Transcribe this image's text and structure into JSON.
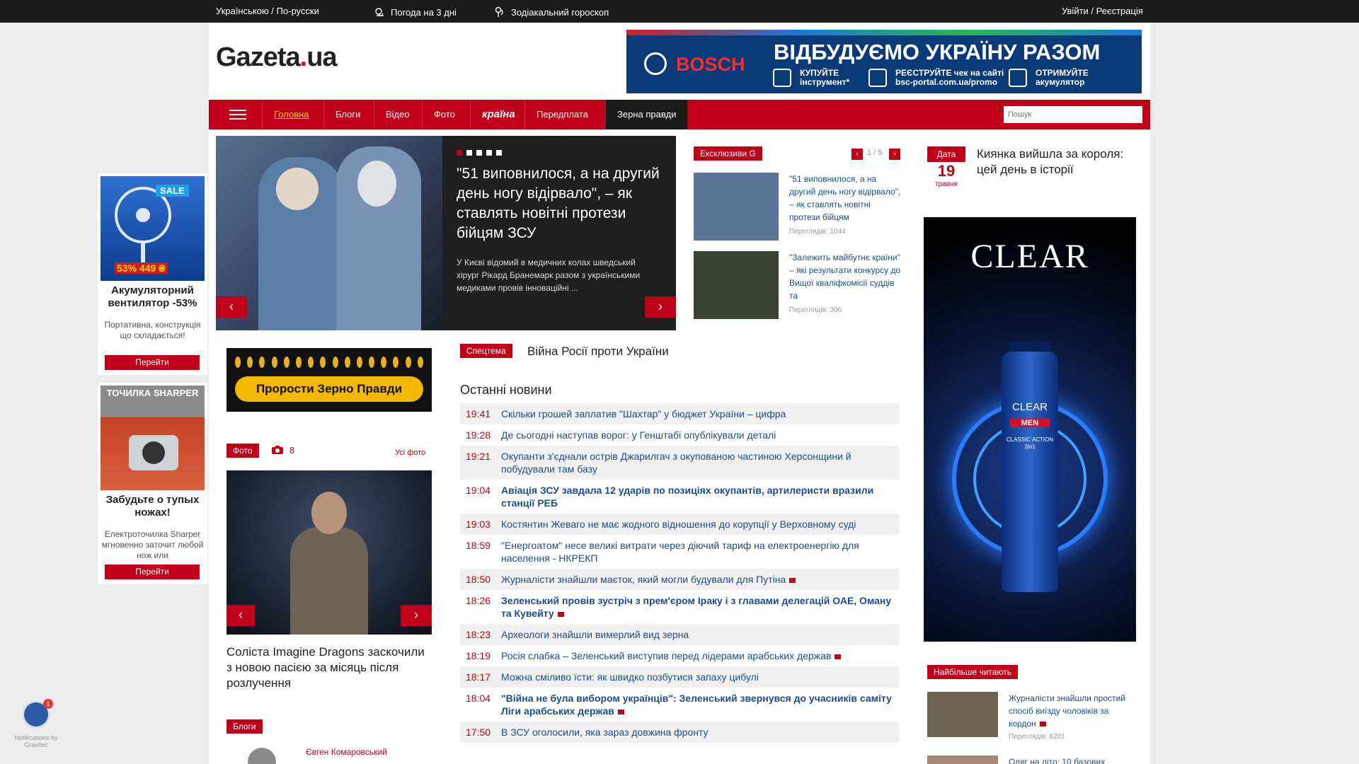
{
  "topbar": {
    "languages": "Українською / По-русски",
    "weather": "Погода на 3 дні",
    "horoscope": "Зодіакальний гороскоп",
    "auth": "Увійти / Реєстрація"
  },
  "logo": {
    "name": "Gazeta",
    "dot": ".",
    "tld": "ua"
  },
  "banner": {
    "brand": "BOSCH",
    "headline": "ВІДБУДУЄМО УКРАЇНУ РАЗОМ",
    "promo1": "КУПУЙТЕ інструмент*",
    "promo2": "РЕЄСТРУЙТЕ чек на сайті bsc-portal.com.ua/promo",
    "promo3": "ОТРИМУЙТЕ акумулятор"
  },
  "nav": {
    "items": [
      "Головна",
      "Блоги",
      "Відео",
      "Фото",
      "країна",
      "Передплата",
      "Зерна правди"
    ],
    "search_placeholder": "Пошук"
  },
  "hero": {
    "title": "\"51 виповнилося, а на другий день ногу відірвало\", – як ставлять новітні протези бійцям ЗСУ",
    "lead": "У Києві відомий в медичних колах шведський хірург Рікард Бранемарк разом з українськими медиками провів інноваційні ..."
  },
  "exclusives": {
    "badge": "Ексклюзиви G",
    "pager": "1 / 5",
    "items": [
      {
        "title": "\"51 виповнилося, а на другий день ногу відірвало\", – як ставлять новітні протези бійцям",
        "views": "Переглядів: 1044"
      },
      {
        "title": "\"Залежить майбутнє країни\" – які результати конкурсу до Вищої кваліфкомісії суддів та",
        "views": "Переглядів: 306"
      }
    ]
  },
  "date_box": {
    "label": "Дата",
    "day": "19",
    "month": "травня",
    "title": "Киянка вийшла за короля: цей день в історії"
  },
  "zerno": {
    "button": "Прорости Зерно Правди"
  },
  "photo_block": {
    "badge": "Фото",
    "count": "8",
    "all": "Усі фото",
    "caption": "Соліста Imagine Dragons заскочили з новою пасією за місяць після розлучення"
  },
  "blogs": {
    "badge": "Блоги",
    "author": "Євген Комаровський"
  },
  "special": {
    "badge": "Спецтема",
    "title": "Війна Росії проти України"
  },
  "latest": {
    "heading": "Останні новини",
    "items": [
      {
        "time": "19:41",
        "title": "Скільки грошей заплатив \"Шахтар\" у бюджет України – цифра",
        "bold": false,
        "video": false
      },
      {
        "time": "19:28",
        "title": "Де сьогодні наступав ворог: у Генштабі опублікували деталі",
        "bold": false,
        "video": false
      },
      {
        "time": "19:21",
        "title": "Окупанти з'єднали острів Джарилгач з окупованою частиною Херсонщини й побудували там базу",
        "bold": false,
        "video": false
      },
      {
        "time": "19:04",
        "title": "Авіація ЗСУ завдала 12 ударів по позиціях окупантів, артилеристи вразили станції РЕБ",
        "bold": true,
        "video": false
      },
      {
        "time": "19:03",
        "title": "Костянтин Жеваго не має жодного відношення до корупції у Верховному суді",
        "bold": false,
        "video": false
      },
      {
        "time": "18:59",
        "title": "\"Енергоатом\" несе великі витрати через діючий тариф на електроенергію для населення - НКРЕКП",
        "bold": false,
        "video": false
      },
      {
        "time": "18:50",
        "title": "Журналісти знайшли маєток, який могли будували для Путіна",
        "bold": false,
        "video": true
      },
      {
        "time": "18:26",
        "title": "Зеленський провів зустріч з прем'єром Іраку і з главами делегацій ОАЕ, Оману та Кувейту",
        "bold": true,
        "video": true
      },
      {
        "time": "18:23",
        "title": "Археологи знайшли вимерлий вид зерна",
        "bold": false,
        "video": false
      },
      {
        "time": "18:19",
        "title": "Росія слабка – Зеленський виступив перед лідерами арабських держав",
        "bold": false,
        "video": true
      },
      {
        "time": "18:17",
        "title": "Можна сміливо їсти: як швидко позбутися запаху цибулі",
        "bold": false,
        "video": false
      },
      {
        "time": "18:04",
        "title": "\"Війна не була вибором українців\": Зеленський звернувся до учасників саміту Ліги арабських держав",
        "bold": true,
        "video": true
      },
      {
        "time": "17:50",
        "title": "В ЗСУ оголосили, яка зараз довжина фронту",
        "bold": false,
        "video": false
      }
    ]
  },
  "clear_ad": {
    "brand": "CLEAR",
    "bottle_brand": "CLEAR",
    "men": "MEN",
    "line": "CLASSIC ACTION 2in1"
  },
  "most_read": {
    "badge": "Найбільше читають",
    "items": [
      {
        "title": "Журналісти знайшли простий спосіб виїзду чоловіків за кордон",
        "views": "Переглядів: 6201"
      },
      {
        "title": "Одяг на літо: 10 базових"
      }
    ]
  },
  "side_ads": [
    {
      "sale": "SALE",
      "price": "53% 449 ₴",
      "title": "Акумуляторний вентилятор -53%",
      "desc": "Портативна, конструкція що складається!",
      "button": "Перейти"
    },
    {
      "brand": "ТОЧИЛКА SHARPER",
      "title": "Забудьте о тупых ножах!",
      "desc": "Електроточилка Sharper мгновенно заточит любой нож или",
      "button": "Перейти"
    }
  ],
  "notifications": {
    "count": "1",
    "caption": "Notifications by Gravitec"
  }
}
